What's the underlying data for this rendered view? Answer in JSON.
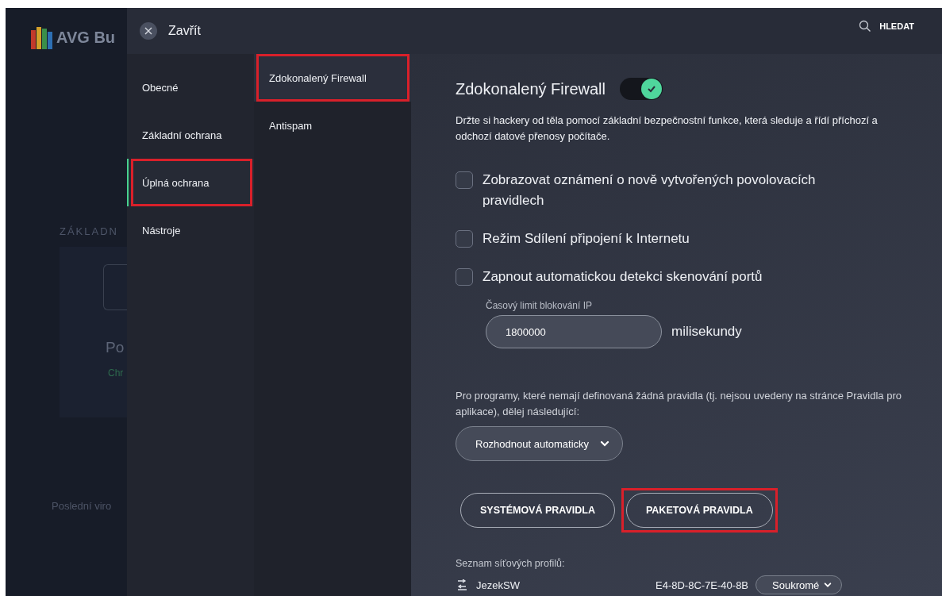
{
  "background_app": {
    "logo_text": "AVG Bu",
    "section_heading": "ZÁKLADN",
    "card_title": "Po",
    "card_status": "Chr",
    "footer_text": "Poslední viro"
  },
  "header": {
    "close_label": "Zavřít",
    "search_label": "HLEDAT"
  },
  "categories": [
    {
      "label": "Obecné",
      "selected": false,
      "highlighted": false
    },
    {
      "label": "Základní ochrana",
      "selected": false,
      "highlighted": false
    },
    {
      "label": "Úplná ochrana",
      "selected": true,
      "highlighted": true
    },
    {
      "label": "Nástroje",
      "selected": false,
      "highlighted": false
    }
  ],
  "subcategories": [
    {
      "label": "Zdokonalený Firewall",
      "selected": true,
      "highlighted": true
    },
    {
      "label": "Antispam",
      "selected": false,
      "highlighted": false
    }
  ],
  "content": {
    "title": "Zdokonalený Firewall",
    "enabled": true,
    "description": "Držte si hackery od těla pomocí základní bezpečnostní funkce, která sleduje a řídí příchozí a odchozí datové přenosy počítače.",
    "options": [
      {
        "label": "Zobrazovat oznámení o nově vytvořených povolovacích pravidlech",
        "checked": false
      },
      {
        "label": "Režim Sdílení připojení k Internetu",
        "checked": false
      },
      {
        "label": "Zapnout automatickou detekci skenování portů",
        "checked": false
      }
    ],
    "timeout": {
      "label": "Časový limit blokování IP",
      "value": "1800000",
      "unit": "milisekundy"
    },
    "default_action": {
      "text": "Pro programy, které nemají definovaná žádná pravidla (tj. nejsou uvedeny na stránce Pravidla pro aplikace), dělej následující:",
      "value": "Rozhodnout automaticky"
    },
    "rule_buttons": [
      {
        "label": "SYSTÉMOVÁ PRAVIDLA",
        "highlighted": false
      },
      {
        "label": "PAKETOVÁ PRAVIDLA",
        "highlighted": true
      }
    ],
    "profiles_label": "Seznam síťových profilů:",
    "profiles": [
      {
        "name": "JezekSW",
        "mac": "E4-8D-8C-7E-40-8B",
        "type": "Soukromé"
      }
    ]
  }
}
